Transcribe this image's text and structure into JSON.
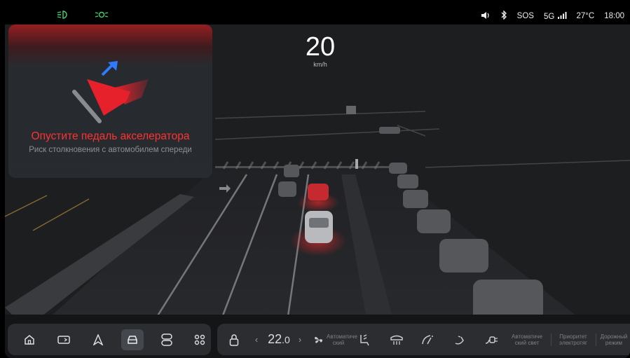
{
  "status": {
    "indicators": [
      "low-beam-icon",
      "parking-lights-icon"
    ],
    "volume_icon": "volume-icon",
    "bluetooth_icon": "bluetooth-icon",
    "sos": "SOS",
    "network": "5G",
    "temperature": "27°C",
    "time": "18:00",
    "indicator_color": "#41d36b"
  },
  "speed": {
    "value": "20",
    "unit": "km/h"
  },
  "alert": {
    "title": "Опустите педаль акселератора",
    "subtitle": "Риск столкновения с автомобилем спереди",
    "title_color": "#ff3232"
  },
  "dock": {
    "items": [
      {
        "icon": "home-icon",
        "active": false
      },
      {
        "icon": "screen-switch-icon",
        "active": false
      },
      {
        "icon": "navigation-icon",
        "active": false
      },
      {
        "icon": "car-icon",
        "active": true
      },
      {
        "icon": "toggles-icon",
        "active": false
      },
      {
        "icon": "apps-grid-icon",
        "active": false
      }
    ]
  },
  "climate": {
    "lock_icon": "seat-lock-icon",
    "temperature": "22",
    "temperature_decimal": ".0",
    "fan_label": "Автоматиче ский",
    "auto_light": "Автоматиче ский свет",
    "priority": "Приоритет электротяг",
    "road_mode": "Дорожный режим"
  }
}
